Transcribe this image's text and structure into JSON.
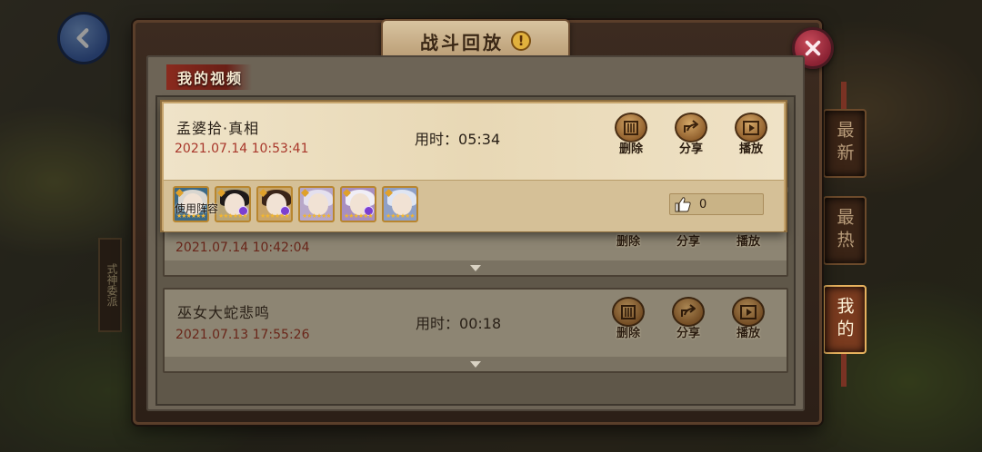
{
  "dialog": {
    "title": "战斗回放",
    "info_glyph": "!",
    "section_label": "我的视频"
  },
  "tabs": [
    {
      "label": "最新",
      "active": false
    },
    {
      "label": "最热",
      "active": false
    },
    {
      "label": "我的",
      "active": true
    }
  ],
  "background": {
    "shrine_label": "式神委派"
  },
  "videos": [
    {
      "name": "孟婆拾·真相",
      "date": "2021.07.14 10:53:41",
      "duration_label": "用时：",
      "duration": "05:34",
      "likes": "0",
      "team_label": "使用阵容",
      "expanded": true
    },
    {
      "name": "",
      "date": "2021.07.14 10:42:04",
      "duration_label": "",
      "duration": "",
      "expanded": false
    },
    {
      "name": "巫女大蛇悲鸣",
      "date": "2021.07.13 17:55:26",
      "duration_label": "用时：",
      "duration": "00:18",
      "expanded": false
    }
  ],
  "actions": {
    "delete": "删除",
    "share": "分享",
    "play": "播放"
  },
  "icons": [
    "back-arrow-icon",
    "info-icon",
    "close-icon",
    "delete-icon",
    "share-icon",
    "play-icon",
    "thumbs-up-icon",
    "expand-arrow-icon"
  ],
  "colors": {
    "active_tab": "#7a3b1f",
    "date_text": "#a8362a",
    "close_button": "#c84a5a",
    "back_button": "#3b5ea5"
  }
}
